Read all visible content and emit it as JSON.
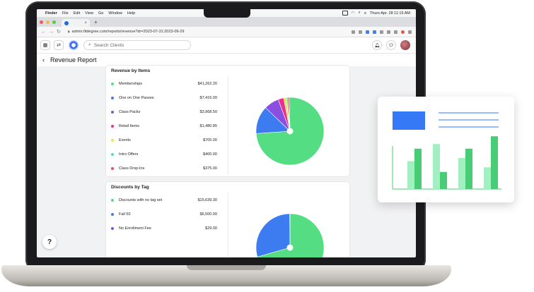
{
  "menubar": {
    "apple": "",
    "items": [
      "Finder",
      "File",
      "Edit",
      "View",
      "Go",
      "Window",
      "Help"
    ],
    "clock": "Thurs Apr. 28 11:15 AM"
  },
  "browser": {
    "url": "admin.fitdegree.com/reports/revenue?dr=2023-07-31:2023-09-29",
    "new_tab": "+",
    "tab_close": "×"
  },
  "header": {
    "search_placeholder": "Search Clients"
  },
  "page": {
    "title": "Revenue Report",
    "back": "‹"
  },
  "colors": {
    "green": "#55dd84",
    "blue": "#3c7cf0",
    "purple": "#8a4fe0",
    "pink": "#ea2f8c",
    "yellow": "#f2e04a",
    "teal": "#55dbc3",
    "red": "#ec4a5e"
  },
  "revenue_by_items": {
    "title": "Revenue by Items",
    "rows": [
      {
        "label": "Memberships",
        "value": "$41,262.20",
        "color": "#55dd84",
        "amount": 41262.2
      },
      {
        "label": "One on One Passes",
        "value": "$7,416.00",
        "color": "#3c7cf0",
        "amount": 7416.0
      },
      {
        "label": "Class Packs",
        "value": "$3,968.50",
        "color": "#8a4fe0",
        "amount": 3968.5
      },
      {
        "label": "Retail Items",
        "value": "$1,480.85",
        "color": "#ea2f8c",
        "amount": 1480.85
      },
      {
        "label": "Events",
        "value": "$705.00",
        "color": "#f2e04a",
        "amount": 705.0
      },
      {
        "label": "Intro Offers",
        "value": "$400.00",
        "color": "#55dbc3",
        "amount": 400.0
      },
      {
        "label": "Class Drop-Ins",
        "value": "$375.00",
        "color": "#ec4a5e",
        "amount": 375.0
      }
    ]
  },
  "discounts_by_tag": {
    "title": "Discounts by Tag",
    "rows": [
      {
        "label": "Discounts with no tag set",
        "value": "$15,639.30",
        "color": "#55dd84",
        "amount": 15639.3
      },
      {
        "label": "Fall 50",
        "value": "$6,500.00",
        "color": "#3c7cf0",
        "amount": 6500.0
      },
      {
        "label": "No Enrollment Fee",
        "value": "$29.00",
        "color": "#8a4fe0",
        "amount": 29.0
      }
    ]
  },
  "help": {
    "label": "?"
  },
  "widget": {
    "bars": [
      {
        "light": 0.36,
        "dark": 0.52
      },
      {
        "light": 0.58,
        "dark": 0.22
      },
      {
        "light": 0.4,
        "dark": 0.52
      },
      {
        "light": 0.28,
        "dark": 0.68
      }
    ],
    "light_color": "#a2f0c2",
    "dark_color": "#46cd76",
    "block_color": "#3579f6",
    "line_color": "#3579f6"
  }
}
